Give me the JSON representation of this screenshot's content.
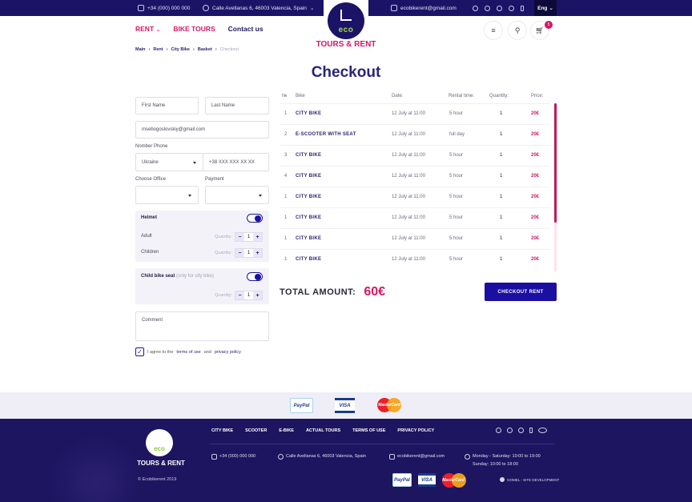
{
  "topbar": {
    "phone": "+34 (000) 000 000",
    "address": "Calle Avellanas 6, 46003 Valencia, Spain",
    "email": "ecobikerent@gmail.com",
    "social_icons": [
      "skype-icon",
      "whatsapp-icon",
      "tripadvisor-icon",
      "instagram-icon",
      "facebook-icon"
    ],
    "language": "Eng"
  },
  "header": {
    "nav": [
      {
        "label": "RENT",
        "has_dropdown": true
      },
      {
        "label": "BIKE TOURS"
      },
      {
        "label": "Contact us"
      }
    ],
    "logo": {
      "mark": "eco",
      "name": "TOURS & RENT"
    },
    "cart_count": "5"
  },
  "breadcrumb": [
    "Main",
    "Rent",
    "City Bike",
    "Basket",
    "Checkout"
  ],
  "page_title": "Checkout",
  "form": {
    "first_name_placeholder": "First Name",
    "last_name_placeholder": "Last Name",
    "email_value": "msebogoslovskiy@gmail.com",
    "phone_label": "Nomber Phone",
    "country_value": "Ukraine",
    "phone_placeholder": "+38 XXX XXX XX XX",
    "office_label": "Choose Office",
    "payment_label": "Payment",
    "helmet": {
      "title": "Helmet",
      "enabled": true,
      "rows": [
        {
          "label": "Adult",
          "qty_label": "Quantity:",
          "qty": "1"
        },
        {
          "label": "Children",
          "qty_label": "Quantity:",
          "qty": "1"
        }
      ]
    },
    "child_seat": {
      "title": "Child bike seat",
      "hint": "(only for city bike)",
      "enabled": true,
      "qty_label": "Quantity:",
      "qty": "1"
    },
    "comment_placeholder": "Comment",
    "agree": {
      "checked": true,
      "prefix": "I agree to the",
      "terms": "terms of use",
      "and": "and",
      "privacy": "privacy policy"
    }
  },
  "table": {
    "headers": [
      "№",
      "Bike",
      "Date:",
      "Rental time:",
      "Quantity:",
      "Price:"
    ],
    "rows": [
      {
        "no": "1",
        "bike": "CITY BIKE",
        "date": "12 July at 11:00",
        "time": "5 hour",
        "qty": "1",
        "price": "20€"
      },
      {
        "no": "2",
        "bike": "E-SCOOTER WITH SEAT",
        "date": "12 July at 11:00",
        "time": "full day",
        "qty": "1",
        "price": "20€"
      },
      {
        "no": "3",
        "bike": "CITY BIKE",
        "date": "12 July at 11:00",
        "time": "5 hour",
        "qty": "1",
        "price": "20€"
      },
      {
        "no": "4",
        "bike": "CITY BIKE",
        "date": "12 July at 11:00",
        "time": "5 hour",
        "qty": "1",
        "price": "20€"
      },
      {
        "no": "1",
        "bike": "CITY BIKE",
        "date": "12 July at 11:00",
        "time": "5 hour",
        "qty": "1",
        "price": "20€"
      },
      {
        "no": "1",
        "bike": "CITY BIKE",
        "date": "12 July at 11:00",
        "time": "5 hour",
        "qty": "1",
        "price": "20€"
      },
      {
        "no": "1",
        "bike": "CITY BIKE",
        "date": "12 July at 11:00",
        "time": "5 hour",
        "qty": "1",
        "price": "20€"
      },
      {
        "no": "1",
        "bike": "CITY BIKE",
        "date": "12 July at 11:00",
        "time": "5 hour",
        "qty": "1",
        "price": "20€"
      }
    ],
    "scroll_position_fraction": 0.0,
    "scroll_visible_fraction": 0.71
  },
  "total": {
    "label": "TOTAL AMOUNT:",
    "amount": "60€"
  },
  "checkout_button": "CHECKOUT RENT",
  "payments": [
    "PayPal",
    "VISA",
    "MasterCard"
  ],
  "footer": {
    "brand": "TOURS & RENT",
    "logo_mark": "eco",
    "copyright": "© Ecobikerent 2019",
    "links": [
      "CITY BIKE",
      "SCOOTER",
      "E-BIKE",
      "ACTUAL TOURS",
      "TERMS OF USE",
      "PRIVACY POLICY"
    ],
    "social_icons": [
      "skype-icon",
      "whatsapp-icon",
      "instagram-icon",
      "facebook-icon",
      "tripadvisor-icon"
    ],
    "phone": "+34 (000) 000 000",
    "address": "Calle Avellanas 6, 46003 Valencia, Spain",
    "email": "ecobikerent@gmail.com",
    "hours_weekdays": "Monday - Saturday: 10:00 to 19:00",
    "hours_sunday": "Sunday: 10:00 to 18:00",
    "developer": "GOMEL - SITE DEVELOPMENT"
  },
  "colors": {
    "brand_navy": "#1b1466",
    "accent_pink": "#d31866",
    "button_blue": "#1a0fa0",
    "eco_green": "#9fd84d"
  }
}
